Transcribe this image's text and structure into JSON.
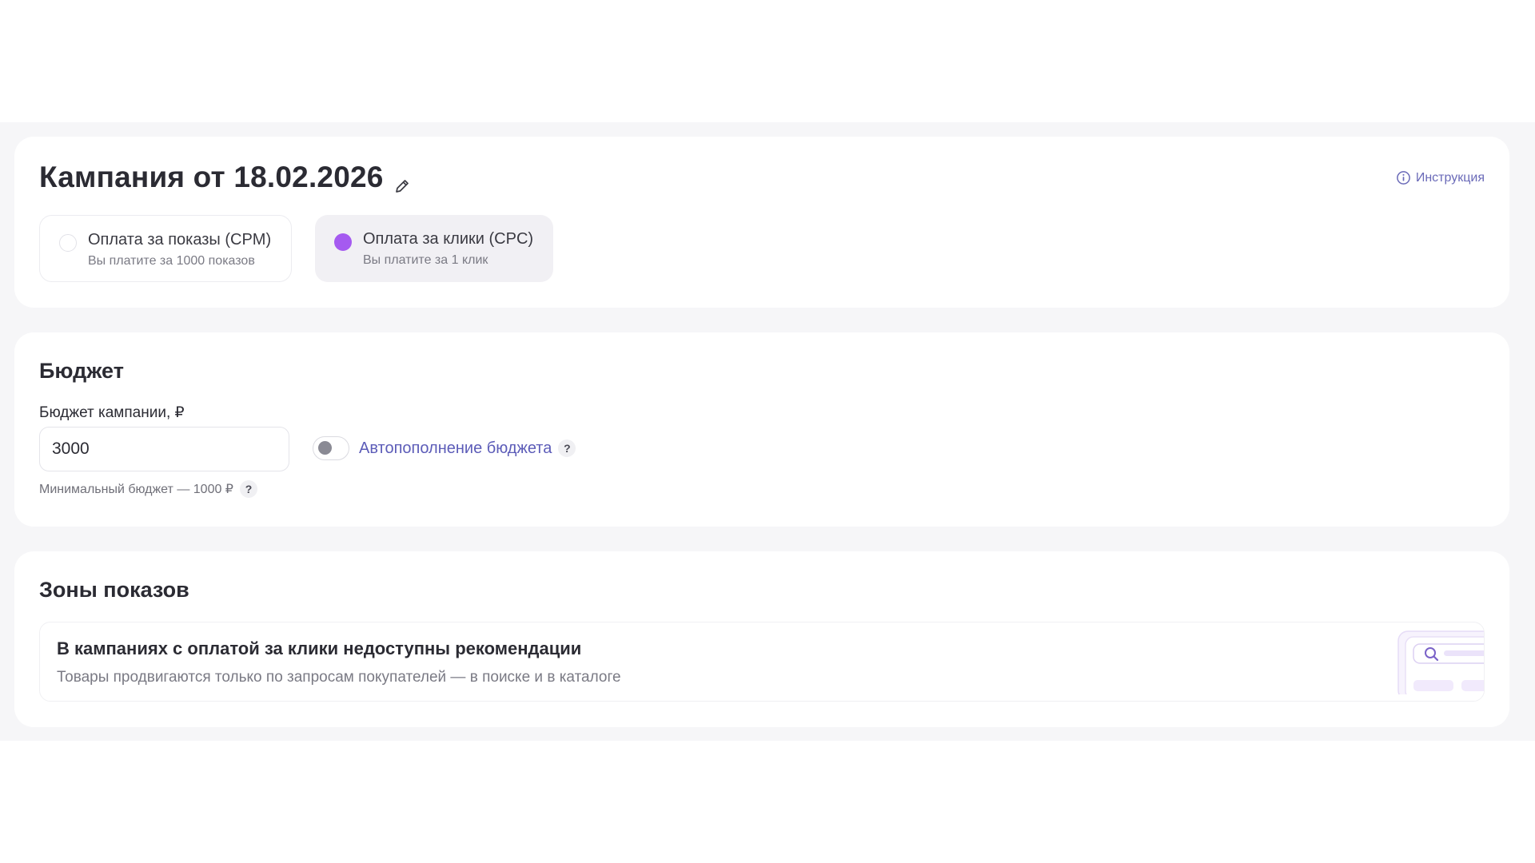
{
  "campaign": {
    "title": "Кампания от 18.02.2026",
    "instruction_label": "Инструкция",
    "payment_options": [
      {
        "title": "Оплата за показы (CPM)",
        "subtitle": "Вы платите за 1000 показов",
        "selected": false
      },
      {
        "title": "Оплата за клики (CPC)",
        "subtitle": "Вы платите за 1 клик",
        "selected": true
      }
    ]
  },
  "budget": {
    "section_title": "Бюджет",
    "field_label": "Бюджет кампании, ₽",
    "value": "3000",
    "min_note": "Минимальный бюджет — 1000 ₽",
    "auto_topup_label": "Автопополнение бюджета",
    "auto_topup_enabled": false,
    "help_mark": "?"
  },
  "zones": {
    "section_title": "Зоны показов",
    "notice_title": "В кампаниях с оплатой за клики недоступны рекомендации",
    "notice_text": "Товары продвигаются только по запросам покупателей — в поиске и в каталоге"
  },
  "colors": {
    "accent": "#a55af0",
    "link": "#5c5cb8",
    "band": "#f6f6f8"
  },
  "icons": [
    "edit-icon",
    "info-icon",
    "help-icon",
    "search-icon"
  ]
}
